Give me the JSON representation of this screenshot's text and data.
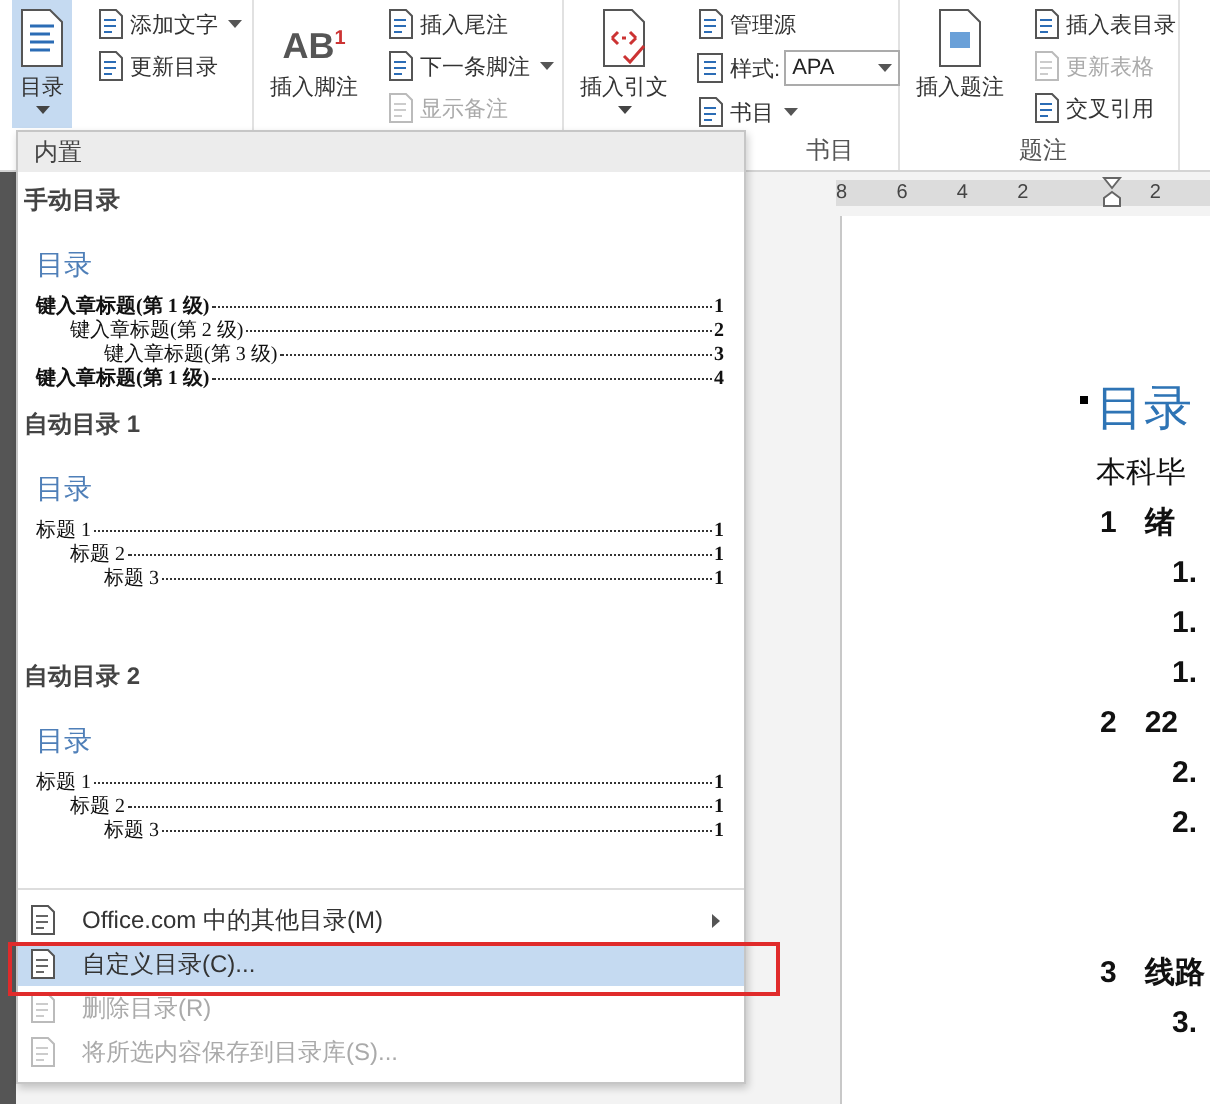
{
  "ribbon": {
    "groups": [
      {
        "large": {
          "label": "目录",
          "dropdown": true,
          "selected": true
        },
        "small": [
          {
            "kind": "button",
            "label": "添加文字",
            "dropdown": true,
            "disabled": false
          },
          {
            "kind": "button",
            "label": "更新目录",
            "dropdown": false,
            "disabled": false
          }
        ]
      },
      {
        "large": {
          "label": "插入脚注",
          "dropdown": false,
          "selected": false,
          "icon_text": "AB",
          "icon_mark": "1"
        },
        "small": [
          {
            "kind": "button",
            "label": "插入尾注",
            "dropdown": false,
            "disabled": false
          },
          {
            "kind": "button",
            "label": "下一条脚注",
            "dropdown": true,
            "disabled": false
          },
          {
            "kind": "button",
            "label": "显示备注",
            "dropdown": false,
            "disabled": true
          }
        ]
      },
      {
        "label": "书目",
        "large": {
          "label": "插入引文",
          "dropdown": true,
          "selected": false
        },
        "small": [
          {
            "kind": "button",
            "label": "管理源",
            "dropdown": false,
            "disabled": false
          },
          {
            "kind": "select",
            "label": "样式:",
            "value": "APA"
          },
          {
            "kind": "button",
            "label": "书目",
            "dropdown": true,
            "disabled": false
          }
        ]
      },
      {
        "label": "题注",
        "large": {
          "label": "插入题注",
          "dropdown": false,
          "selected": false
        },
        "small": [
          {
            "kind": "button",
            "label": "插入表目录",
            "dropdown": false,
            "disabled": false
          },
          {
            "kind": "button",
            "label": "更新表格",
            "dropdown": false,
            "disabled": true
          },
          {
            "kind": "button",
            "label": "交叉引用",
            "dropdown": false,
            "disabled": false
          }
        ]
      }
    ]
  },
  "menu": {
    "header": "内置",
    "gallery": [
      {
        "title": "手动目录",
        "preview": {
          "heading": "目录",
          "entries": [
            {
              "text": "键入章标题(第 1 级)",
              "page": "1",
              "children": [
                {
                  "text": "键入章标题(第 2 级)",
                  "page": "2",
                  "children": [
                    {
                      "text": "键入章标题(第 3 级)",
                      "page": "3"
                    }
                  ]
                }
              ]
            },
            {
              "text": "键入章标题(第 1 级)",
              "page": "4"
            }
          ]
        }
      },
      {
        "title": "自动目录 1",
        "preview": {
          "heading": "目录",
          "entries": [
            {
              "text": "标题 1",
              "page": "1",
              "children": [
                {
                  "text": "标题 2",
                  "page": "1",
                  "children": [
                    {
                      "text": "标题 3",
                      "page": "1"
                    }
                  ]
                }
              ]
            }
          ]
        }
      },
      {
        "title": "自动目录 2",
        "preview": {
          "heading": "目录",
          "entries": [
            {
              "text": "标题 1",
              "page": "1",
              "children": [
                {
                  "text": "标题 2",
                  "page": "1",
                  "children": [
                    {
                      "text": "标题 3",
                      "page": "1"
                    }
                  ]
                }
              ]
            }
          ]
        }
      }
    ],
    "items": [
      {
        "label": "Office.com 中的其他目录(M)",
        "submenu": true,
        "selected": false,
        "disabled": false
      },
      {
        "label": "自定义目录(C)...",
        "submenu": false,
        "selected": true,
        "disabled": false
      },
      {
        "label": "删除目录(R)",
        "submenu": false,
        "selected": false,
        "disabled": true
      },
      {
        "label": "将所选内容保存到目录库(S)...",
        "submenu": false,
        "selected": false,
        "disabled": true
      }
    ]
  },
  "document": {
    "ruler": [
      "8",
      "6",
      "4",
      "2",
      "2"
    ],
    "heading": "目录",
    "intro": "本科毕",
    "outline": [
      {
        "number": "1",
        "title": "绪",
        "children": [
          {
            "number": "1."
          },
          {
            "number": "1."
          },
          {
            "number": "1."
          }
        ]
      },
      {
        "number": "2",
        "title": "22",
        "children": [
          {
            "number": "2."
          },
          {
            "number": "2."
          }
        ]
      },
      {
        "number": "3",
        "title": "线路",
        "children": [
          {
            "number": "3."
          }
        ]
      }
    ]
  }
}
